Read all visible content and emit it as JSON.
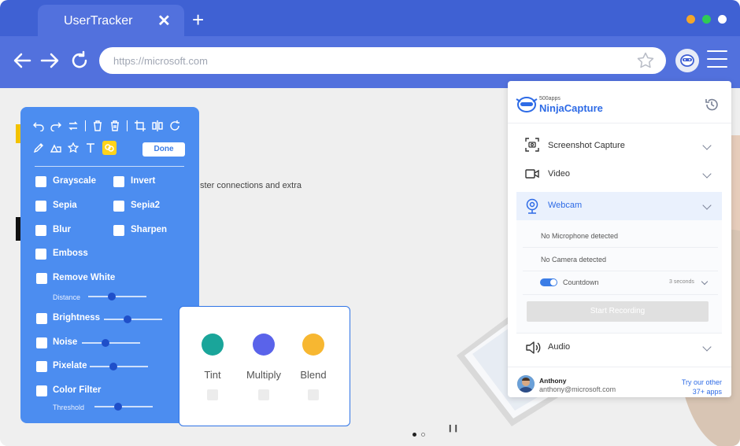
{
  "browser": {
    "tab_title": "UserTracker",
    "tab_close": "✕",
    "new_tab": "+",
    "url_placeholder": "https://microsoft.com",
    "traffic_lights": [
      "#f4a62a",
      "#2fcb55",
      "#ffffff"
    ]
  },
  "page": {
    "snippet": "ster connections and extra"
  },
  "editor": {
    "done_label": "Done",
    "options": [
      {
        "label": "Grayscale"
      },
      {
        "label": "Invert"
      },
      {
        "label": "Sepia"
      },
      {
        "label": "Sepia2"
      },
      {
        "label": "Blur"
      },
      {
        "label": "Sharpen"
      },
      {
        "label": "Emboss"
      },
      {
        "label": "Remove White"
      },
      {
        "label": "Brightness"
      },
      {
        "label": "Noise"
      },
      {
        "label": "Pixelate"
      },
      {
        "label": "Color Filter"
      }
    ],
    "distance_label": "Distance",
    "threshold_label": "Threshold",
    "sliders": {
      "distance": 0.4,
      "brightness": 0.4,
      "noise": 0.4,
      "pixelate": 0.4,
      "threshold": 0.4
    }
  },
  "color_filters": [
    {
      "label": "Tint",
      "color": "#1aa59a"
    },
    {
      "label": "Multiply",
      "color": "#5a63ea"
    },
    {
      "label": "Blend",
      "color": "#f7b731"
    }
  ],
  "capture": {
    "brand_top": "500apps",
    "brand_name": "NinjaCapture",
    "sections": {
      "screenshot": "Screenshot Capture",
      "video": "Video",
      "webcam": "Webcam",
      "audio": "Audio"
    },
    "no_mic": "No Microphone detected",
    "no_camera": "No Camera detected",
    "countdown_label": "Countdown",
    "countdown_value": "3 seconds",
    "start_button": "Start Recording",
    "user_name": "Anthony",
    "user_email": "anthony@microsoft.com",
    "try_line1": "Try our other",
    "try_line2": "37+ apps"
  },
  "accent_color": "#3f61d3"
}
